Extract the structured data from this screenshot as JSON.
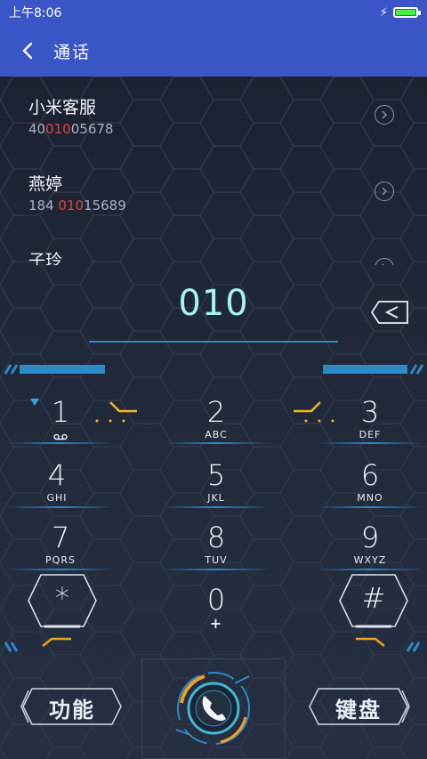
{
  "status_bar": {
    "time": "上午8:06",
    "charging_icon": "bolt-icon",
    "battery_level": 1.0
  },
  "header": {
    "title": "通话",
    "back_icon": "chevron-left-icon"
  },
  "contacts": [
    {
      "name": "小米客服",
      "number_before": "40",
      "number_match": "010",
      "number_after": "05678"
    },
    {
      "name": "燕婷",
      "number_before": "184 ",
      "number_match": "010",
      "number_after": "15689"
    },
    {
      "name": "子玲",
      "number_before": "",
      "number_match": "",
      "number_after": ""
    }
  ],
  "dialer": {
    "digits": "010"
  },
  "keypad": [
    {
      "digit": "1",
      "letters": ""
    },
    {
      "digit": "2",
      "letters": "ABC"
    },
    {
      "digit": "3",
      "letters": "DEF"
    },
    {
      "digit": "4",
      "letters": "GHI"
    },
    {
      "digit": "5",
      "letters": "JKL"
    },
    {
      "digit": "6",
      "letters": "MNO"
    },
    {
      "digit": "7",
      "letters": "PQRS"
    },
    {
      "digit": "8",
      "letters": "TUV"
    },
    {
      "digit": "9",
      "letters": "WXYZ"
    },
    {
      "digit": "*",
      "letters": ""
    },
    {
      "digit": "0",
      "letters": "+"
    },
    {
      "digit": "#",
      "letters": ""
    }
  ],
  "bottom": {
    "function_label": "功能",
    "keyboard_label": "键盘",
    "call_icon": "phone-icon"
  },
  "colors": {
    "header_bg": "#3a55c6",
    "accent_blue": "#2d8ac8",
    "accent_orange": "#f0a020",
    "digits": "#a7f2f2",
    "match_red": "#e2433f"
  }
}
